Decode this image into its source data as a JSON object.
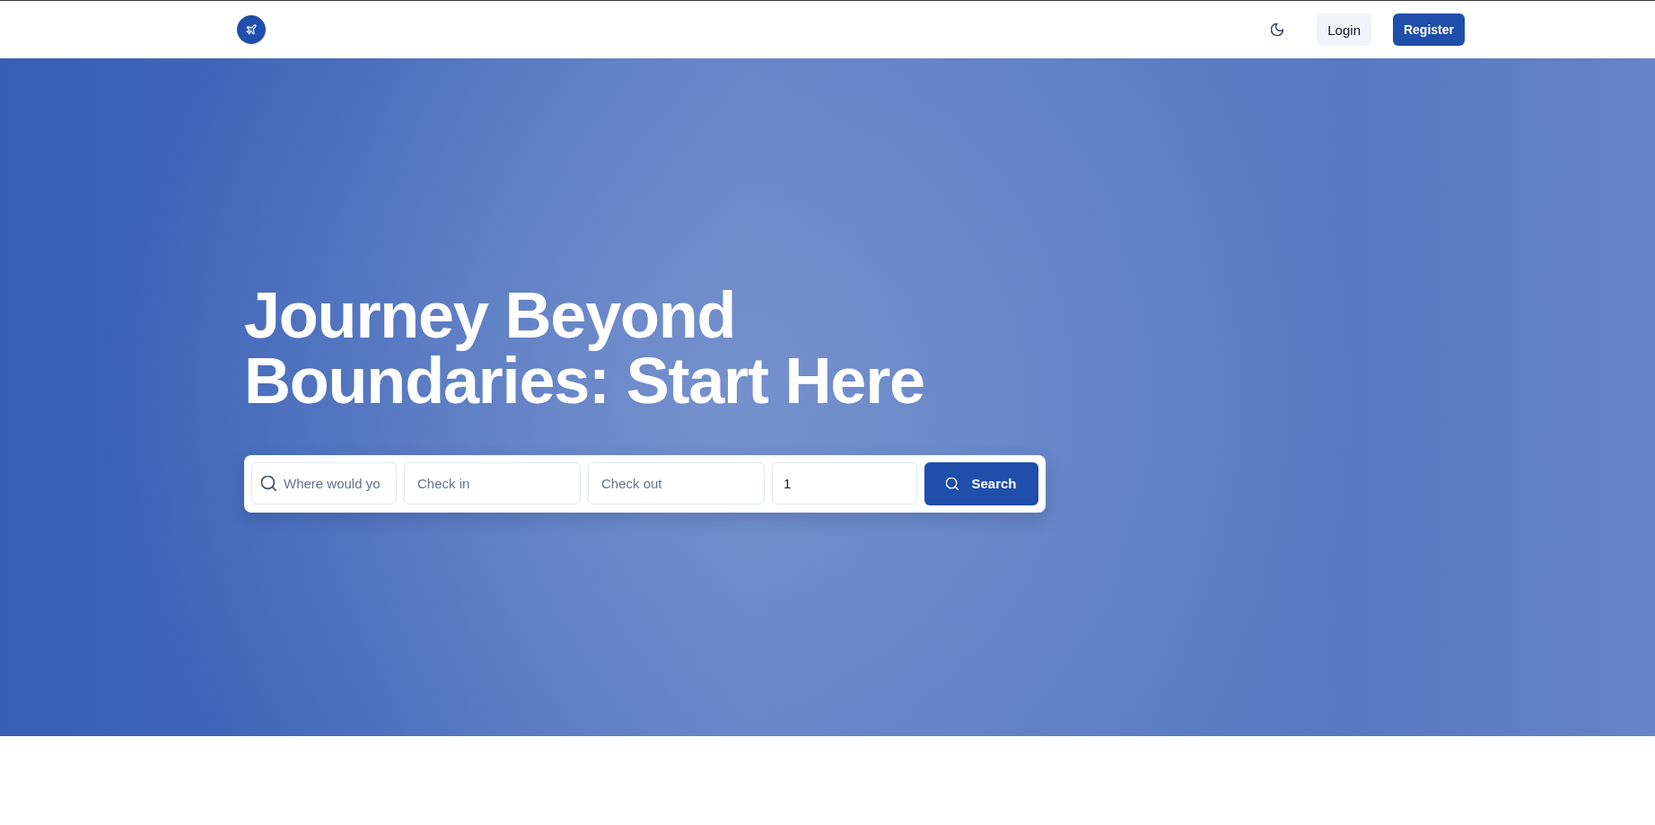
{
  "nav": {
    "buttons": [
      {
        "label": "Login",
        "kind": "secondary"
      },
      {
        "label": "Register",
        "kind": "primary"
      }
    ]
  },
  "hero": {
    "title": "Journey Beyond Boundaries: Start Here"
  },
  "search": {
    "fields": [
      {
        "kind": "destination",
        "placeholder": "Where would yo"
      },
      {
        "kind": "date",
        "placeholder": "Check in"
      },
      {
        "kind": "date",
        "placeholder": "Check out"
      },
      {
        "kind": "guests",
        "value": "1"
      }
    ],
    "button": {
      "label": "Search"
    }
  }
}
